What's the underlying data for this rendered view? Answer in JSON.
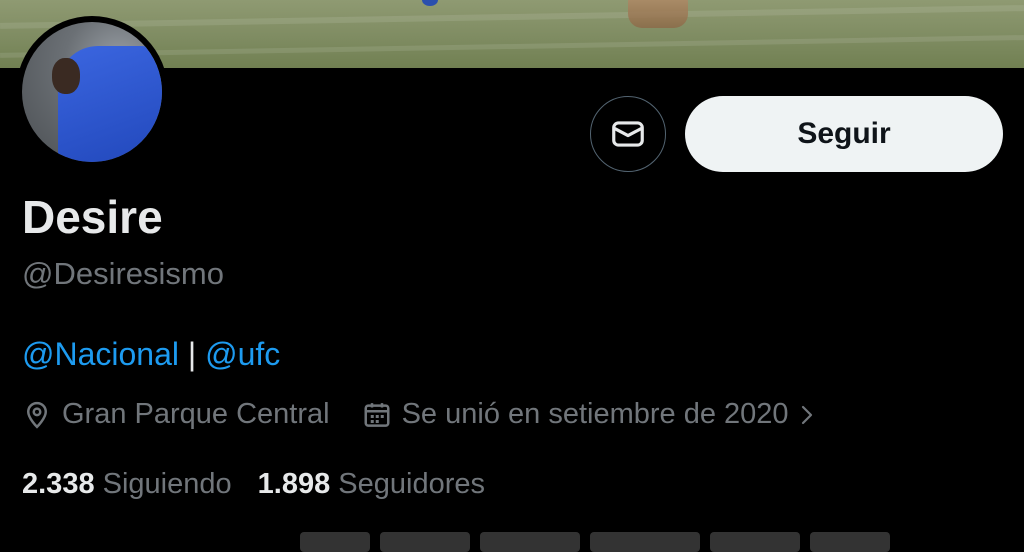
{
  "profile": {
    "display_name": "Desire",
    "handle": "@Desiresismo"
  },
  "actions": {
    "follow_label": "Seguir",
    "message_icon": "envelope-icon"
  },
  "bio": {
    "mention_1": "@Nacional",
    "separator": " | ",
    "mention_2": "@ufc"
  },
  "meta": {
    "location": "Gran Parque Central",
    "joined": "Se unió en setiembre de 2020"
  },
  "stats": {
    "following_count": "2.338",
    "following_label": "Siguiendo",
    "followers_count": "1.898",
    "followers_label": "Seguidores"
  },
  "colors": {
    "background": "#000000",
    "link": "#1d9bf0",
    "secondary_text": "#71767b",
    "follow_button_bg": "#eff3f4"
  }
}
